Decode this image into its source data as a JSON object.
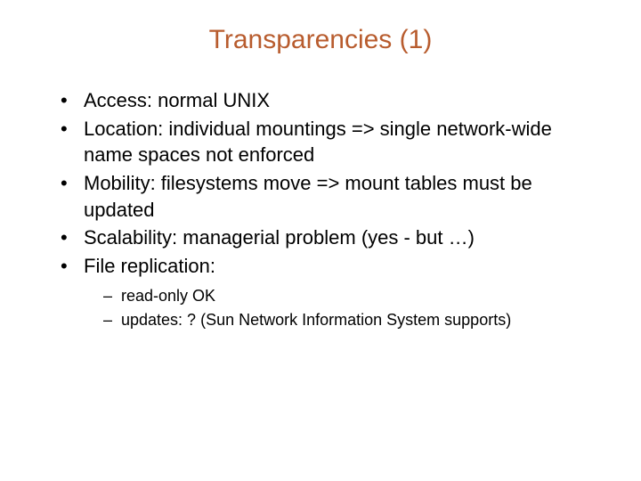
{
  "title": {
    "main": "Transparencies",
    "num": "(1)"
  },
  "bullets": [
    {
      "text": "Access: normal UNIX"
    },
    {
      "text": "Location: individual mountings => single network-wide name spaces not enforced"
    },
    {
      "text": "Mobility: filesystems move => mount tables must be updated"
    },
    {
      "text": "Scalability: managerial problem (yes - but …)"
    },
    {
      "text": "File replication:",
      "sub": [
        "read-only OK",
        "updates: ? (Sun Network Information System supports)"
      ]
    }
  ]
}
